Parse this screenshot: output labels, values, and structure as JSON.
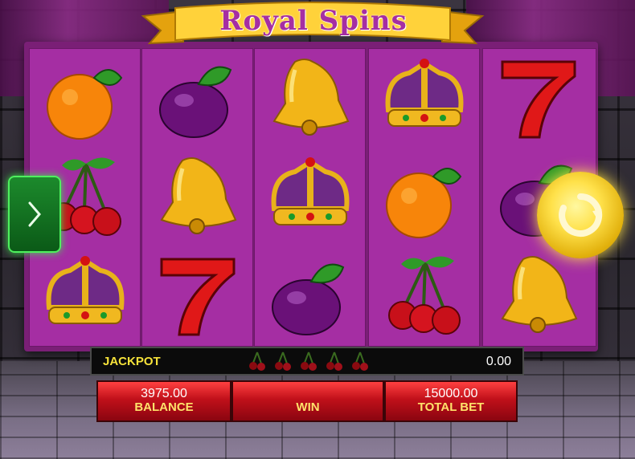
{
  "title": "Royal Spins",
  "jackpot": {
    "label": "JACKPOT",
    "value": "0.00"
  },
  "balance": {
    "value": "3975.00",
    "label": "BALANCE"
  },
  "win": {
    "label": "WIN"
  },
  "total_bet": {
    "value": "15000.00",
    "label": "TOTAL BET"
  },
  "reels": [
    [
      "orange-symbol",
      "cherries-symbol",
      "crown-symbol"
    ],
    [
      "plum-symbol",
      "bell-symbol",
      "seven-symbol"
    ],
    [
      "bell-symbol",
      "crown-symbol",
      "plum-symbol"
    ],
    [
      "crown-symbol",
      "orange-symbol",
      "cherries-symbol"
    ],
    [
      "seven-symbol",
      "plum-symbol",
      "bell-symbol"
    ]
  ],
  "icons": {
    "menu": "chevron-right-icon",
    "spin": "spin-arrow-icon"
  },
  "colors": {
    "reel_bg": "#a52ea3",
    "jackpot_label": "#f6e23a",
    "panel_red": "#c0101a",
    "accent_gold": "#ffe14a"
  }
}
